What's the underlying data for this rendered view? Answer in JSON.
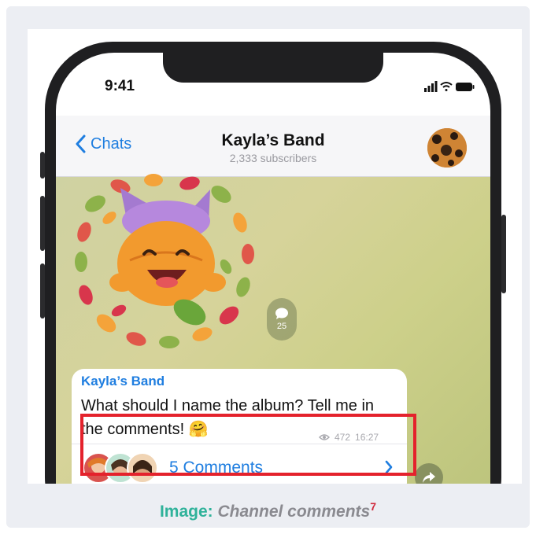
{
  "status_bar": {
    "time": "9:41"
  },
  "chat_header": {
    "back_label": "Chats",
    "title": "Kayla’s Band",
    "subtitle": "2,333 subscribers"
  },
  "sticker_post": {
    "comment_count": "25"
  },
  "message": {
    "author": "Kayla’s Band",
    "text": "What should I name the album? Tell me in the comments! 🤗",
    "views": "472",
    "time": "16:27",
    "comments_label": "5 Comments"
  },
  "caption": {
    "label": "Image:",
    "text": "Channel comments",
    "footnote": "7"
  },
  "colors": {
    "accent_blue": "#1f7ee0",
    "highlight_red": "#e4222c",
    "caption_teal": "#2fb29a"
  },
  "icons": [
    "chevron-left-icon",
    "signal-icon",
    "wifi-icon",
    "battery-icon",
    "comment-icon",
    "views-eye-icon",
    "chevron-right-icon",
    "share-icon"
  ]
}
